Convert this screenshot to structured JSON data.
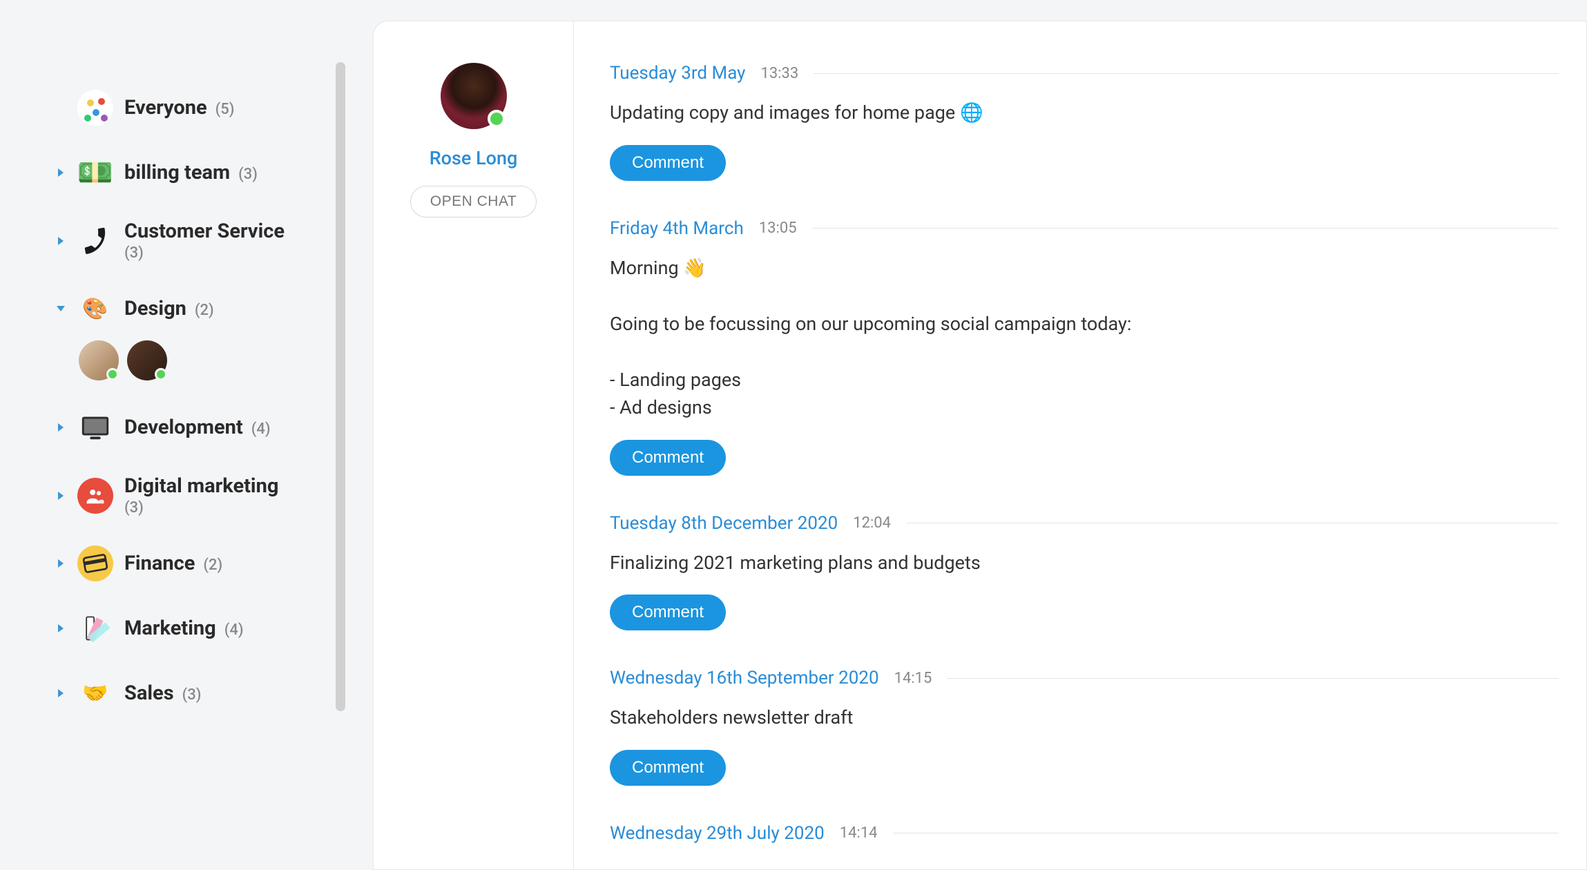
{
  "sidebar": {
    "groups": [
      {
        "id": "everyone",
        "name": "Everyone",
        "count": "(5)",
        "icon": "confetti",
        "chevron": "none",
        "expanded": false
      },
      {
        "id": "billing",
        "name": "billing team",
        "count": "(3)",
        "icon": "cash",
        "chevron": "right",
        "expanded": false
      },
      {
        "id": "customer-service",
        "name": "Customer Service",
        "count": "(3)",
        "icon": "phone",
        "chevron": "right",
        "expanded": false,
        "wrap": true
      },
      {
        "id": "design",
        "name": "Design",
        "count": "(2)",
        "icon": "palette",
        "chevron": "down",
        "expanded": true
      },
      {
        "id": "development",
        "name": "Development",
        "count": "(4)",
        "icon": "screen",
        "chevron": "right",
        "expanded": false
      },
      {
        "id": "digital-marketing",
        "name": "Digital marketing",
        "count": "(3)",
        "icon": "people",
        "chevron": "right",
        "expanded": false,
        "wrap": true
      },
      {
        "id": "finance",
        "name": "Finance",
        "count": "(2)",
        "icon": "card",
        "chevron": "right",
        "expanded": false
      },
      {
        "id": "marketing",
        "name": "Marketing",
        "count": "(4)",
        "icon": "swatch",
        "chevron": "right",
        "expanded": false
      },
      {
        "id": "sales",
        "name": "Sales",
        "count": "(3)",
        "icon": "handshake",
        "chevron": "right",
        "expanded": false
      }
    ]
  },
  "profile": {
    "name": "Rose Long",
    "open_chat_label": "OPEN CHAT"
  },
  "feed": {
    "comment_label": "Comment",
    "entries": [
      {
        "date": "Tuesday 3rd May",
        "time": "13:33",
        "body": "Updating copy and images for home page 🌐"
      },
      {
        "date": "Friday 4th March",
        "time": "13:05",
        "body": "Morning 👋\n\nGoing to be focussing on our upcoming social campaign today:\n\n- Landing pages\n- Ad designs"
      },
      {
        "date": "Tuesday 8th December 2020",
        "time": "12:04",
        "body": "Finalizing 2021 marketing plans and budgets"
      },
      {
        "date": "Wednesday 16th September 2020",
        "time": "14:15",
        "body": "Stakeholders newsletter draft"
      },
      {
        "date": "Wednesday 29th July 2020",
        "time": "14:14",
        "body": ""
      }
    ]
  }
}
